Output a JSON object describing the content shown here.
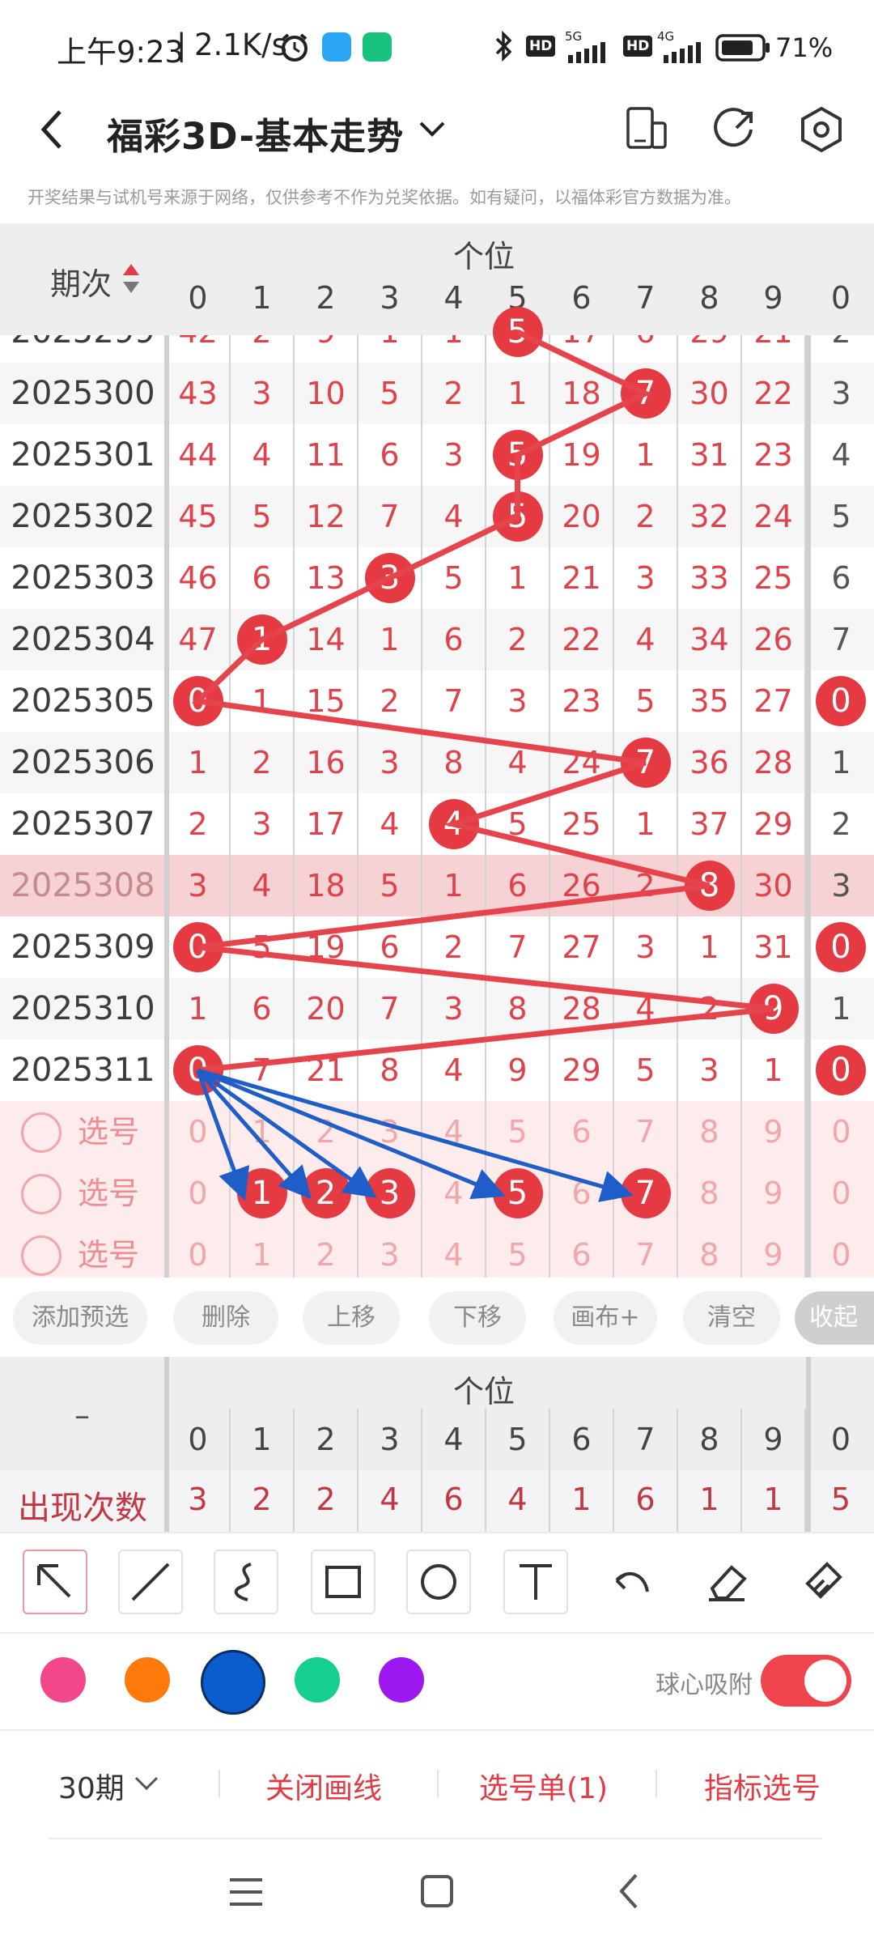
{
  "status_bar": {
    "time": "上午9:23",
    "speed": "2.1K/s",
    "signal_5g": "5G",
    "signal_4g": "4G",
    "hd": "HD",
    "battery": "71%"
  },
  "header": {
    "title": "福彩3D-基本走势"
  },
  "notice": "开奖结果与试机号来源于网络，仅供参考不作为兑奖依据。如有疑问，以福体彩官方数据为准。",
  "table": {
    "issue_header": "期次",
    "group_header": "个位",
    "digit_headers": [
      "0",
      "1",
      "2",
      "3",
      "4",
      "5",
      "6",
      "7",
      "8",
      "9"
    ],
    "extra_header": "0",
    "partial_row": {
      "issue": "2025299",
      "cells": [
        "42",
        "2",
        "9",
        "1",
        "1",
        "5",
        "17",
        "6",
        "29",
        "21"
      ],
      "extra": "2"
    },
    "rows": [
      {
        "issue": "2025300",
        "cells": [
          "43",
          "3",
          "10",
          "5",
          "2",
          "1",
          "18",
          "7",
          "30",
          "22"
        ],
        "extra": "3",
        "win": 7
      },
      {
        "issue": "2025301",
        "cells": [
          "44",
          "4",
          "11",
          "6",
          "3",
          "5",
          "19",
          "1",
          "31",
          "23"
        ],
        "extra": "4",
        "win": 5
      },
      {
        "issue": "2025302",
        "cells": [
          "45",
          "5",
          "12",
          "7",
          "4",
          "5",
          "20",
          "2",
          "32",
          "24"
        ],
        "extra": "5",
        "win": 5
      },
      {
        "issue": "2025303",
        "cells": [
          "46",
          "6",
          "13",
          "3",
          "5",
          "1",
          "21",
          "3",
          "33",
          "25"
        ],
        "extra": "6",
        "win": 3
      },
      {
        "issue": "2025304",
        "cells": [
          "47",
          "1",
          "14",
          "1",
          "6",
          "2",
          "22",
          "4",
          "34",
          "26"
        ],
        "extra": "7",
        "win": 1
      },
      {
        "issue": "2025305",
        "cells": [
          "0",
          "1",
          "15",
          "2",
          "7",
          "3",
          "23",
          "5",
          "35",
          "27"
        ],
        "extra": "0",
        "win": 0
      },
      {
        "issue": "2025306",
        "cells": [
          "1",
          "2",
          "16",
          "3",
          "8",
          "4",
          "24",
          "7",
          "36",
          "28"
        ],
        "extra": "1",
        "win": 7
      },
      {
        "issue": "2025307",
        "cells": [
          "2",
          "3",
          "17",
          "4",
          "4",
          "5",
          "25",
          "1",
          "37",
          "29"
        ],
        "extra": "2",
        "win": 4
      },
      {
        "issue": "2025308",
        "cells": [
          "3",
          "4",
          "18",
          "5",
          "1",
          "6",
          "26",
          "2",
          "8",
          "30"
        ],
        "extra": "3",
        "win": 8
      },
      {
        "issue": "2025309",
        "cells": [
          "0",
          "5",
          "19",
          "6",
          "2",
          "7",
          "27",
          "3",
          "1",
          "31"
        ],
        "extra": "0",
        "win": 0
      },
      {
        "issue": "2025310",
        "cells": [
          "1",
          "6",
          "20",
          "7",
          "3",
          "8",
          "28",
          "4",
          "2",
          "9"
        ],
        "extra": "1",
        "win": 9
      },
      {
        "issue": "2025311",
        "cells": [
          "0",
          "7",
          "21",
          "8",
          "4",
          "9",
          "29",
          "5",
          "3",
          "1"
        ],
        "extra": "0",
        "win": 0
      }
    ],
    "highlight_issue": "2025308",
    "select_label": "选号",
    "select_rows": [
      {
        "digits": [
          "0",
          "1",
          "2",
          "3",
          "4",
          "5",
          "6",
          "7",
          "8",
          "9"
        ],
        "extra": "0",
        "selected": []
      },
      {
        "digits": [
          "0",
          "1",
          "2",
          "3",
          "4",
          "5",
          "6",
          "7",
          "8",
          "9"
        ],
        "extra": "0",
        "selected": [
          1,
          2,
          3,
          5,
          7
        ]
      },
      {
        "digits": [
          "0",
          "1",
          "2",
          "3",
          "4",
          "5",
          "6",
          "7",
          "8",
          "9"
        ],
        "extra": "0",
        "selected": []
      }
    ]
  },
  "actions": [
    "添加预选",
    "删除",
    "上移",
    "下移",
    "画布+",
    "清空"
  ],
  "collapse_label": "收起",
  "stats": {
    "label_dash": "–",
    "group_header": "个位",
    "digit_headers": [
      "0",
      "1",
      "2",
      "3",
      "4",
      "5",
      "6",
      "7",
      "8",
      "9"
    ],
    "extra_header": "0",
    "row_label": "出现次数",
    "counts": [
      "3",
      "2",
      "2",
      "4",
      "6",
      "4",
      "1",
      "6",
      "1",
      "1"
    ],
    "extra_count": "5"
  },
  "tools": [
    "arrow-tool",
    "line-tool",
    "curve-tool",
    "rectangle-tool",
    "circle-tool",
    "text-tool",
    "undo-tool",
    "eraser-tool",
    "clear-brush-tool"
  ],
  "colors": [
    "#f2478b",
    "#ff7a0b",
    "#0b5ccc",
    "#15cf8f",
    "#9b18ee"
  ],
  "selected_color": "#0b5ccc",
  "snap": {
    "label": "球心吸附",
    "on": true,
    "accent": "#f0444d"
  },
  "bottom": {
    "period": "30期",
    "close_lines": "关闭画线",
    "selection_list": "选号单(1)",
    "indicator": "指标选号"
  }
}
